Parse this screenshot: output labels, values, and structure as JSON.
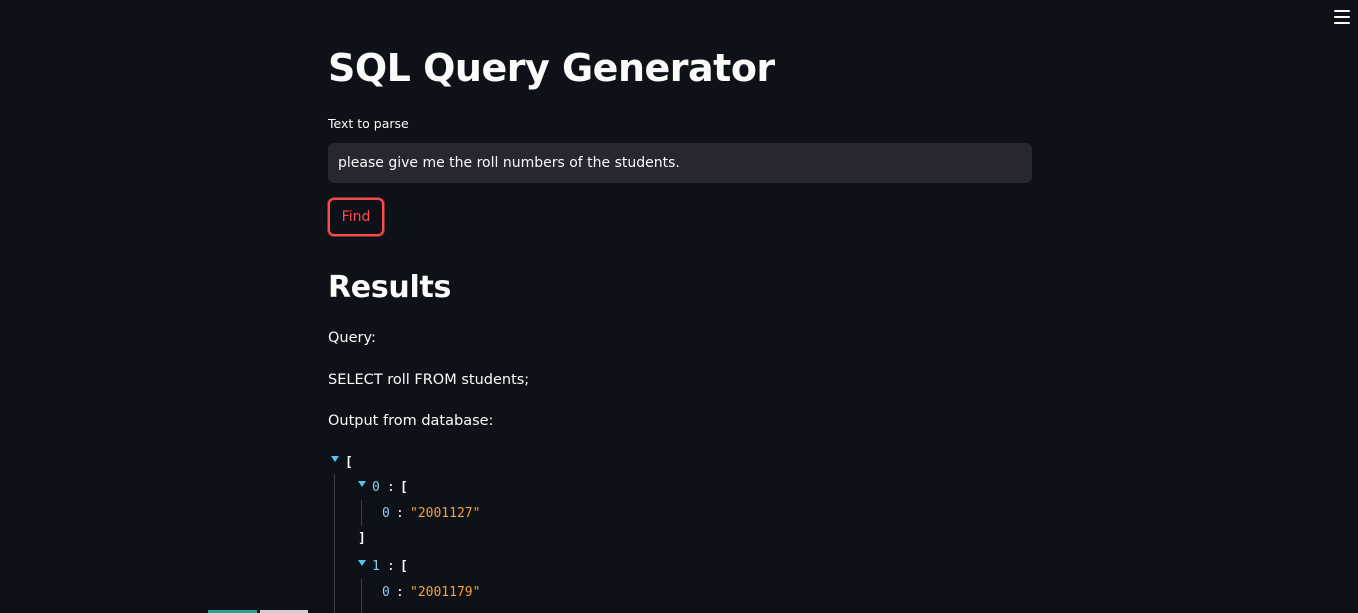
{
  "app": {
    "title": "SQL Query Generator"
  },
  "form": {
    "input_label": "Text to parse",
    "input_value": "please give me the roll numbers of the students.",
    "find_label": "Find"
  },
  "results": {
    "heading": "Results",
    "query_label": "Query:",
    "query_text": "SELECT roll FROM students;",
    "output_label": "Output from database:"
  },
  "json_view": {
    "open_bracket": "[",
    "close_bracket": "]",
    "colon": ":",
    "items": [
      {
        "key": "0",
        "inner_key": "0",
        "value": "\"2001127\""
      },
      {
        "key": "1",
        "inner_key": "0",
        "value": "\"2001179\""
      }
    ]
  },
  "colors": {
    "background": "#0e1117",
    "accent": "#ff4b4b",
    "input_bg": "#262730",
    "json_key": "#8ed0ea",
    "json_string": "#f4a23a",
    "json_toggle": "#5bc0eb"
  },
  "icons": {
    "menu": "hamburger-menu-icon",
    "toggle": "triangle-down-icon"
  }
}
